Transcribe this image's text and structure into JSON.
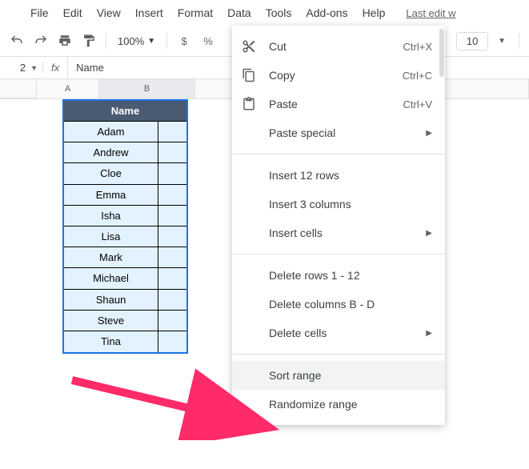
{
  "menubar": {
    "items": [
      "File",
      "Edit",
      "View",
      "Insert",
      "Format",
      "Data",
      "Tools",
      "Add-ons",
      "Help"
    ],
    "last_edit": "Last edit w"
  },
  "toolbar": {
    "zoom": "100%",
    "currency": "$",
    "percent": "%",
    "font_size": "10"
  },
  "formula_bar": {
    "name_box": "2",
    "fx": "fx",
    "value": "Name"
  },
  "columns": [
    "A",
    "B"
  ],
  "table": {
    "header": "Name",
    "rows": [
      "Adam",
      "Andrew",
      "Cloe",
      "Emma",
      "Isha",
      "Lisa",
      "Mark",
      "Michael",
      "Shaun",
      "Steve",
      "Tina"
    ]
  },
  "context_menu": {
    "cut": {
      "label": "Cut",
      "shortcut": "Ctrl+X"
    },
    "copy": {
      "label": "Copy",
      "shortcut": "Ctrl+C"
    },
    "paste": {
      "label": "Paste",
      "shortcut": "Ctrl+V"
    },
    "paste_special": "Paste special",
    "insert_rows": "Insert 12 rows",
    "insert_cols": "Insert 3 columns",
    "insert_cells": "Insert cells",
    "delete_rows": "Delete rows 1 - 12",
    "delete_cols": "Delete columns B - D",
    "delete_cells": "Delete cells",
    "sort_range": "Sort range",
    "randomize_range": "Randomize range"
  }
}
